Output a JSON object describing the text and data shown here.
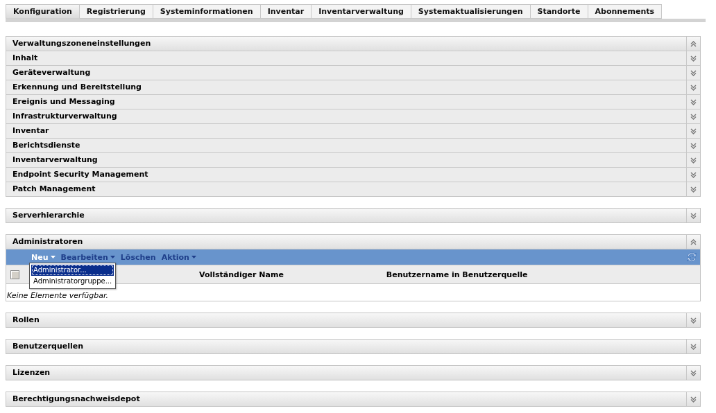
{
  "tabs": [
    {
      "label": "Konfiguration",
      "selected": true
    },
    {
      "label": "Registrierung",
      "selected": false
    },
    {
      "label": "Systeminformationen",
      "selected": false
    },
    {
      "label": "Inventar",
      "selected": false
    },
    {
      "label": "Inventarverwaltung",
      "selected": false
    },
    {
      "label": "Systemaktualisierungen",
      "selected": false
    },
    {
      "label": "Standorte",
      "selected": false
    },
    {
      "label": "Abonnements",
      "selected": false
    }
  ],
  "sections": [
    {
      "title": "Verwaltungszoneneinstellungen",
      "expanded": true,
      "children": [
        {
          "title": "Inhalt",
          "expanded": false
        },
        {
          "title": "Geräteverwaltung",
          "expanded": false
        },
        {
          "title": "Erkennung und Bereitstellung",
          "expanded": false
        },
        {
          "title": "Ereignis und Messaging",
          "expanded": false
        },
        {
          "title": "Infrastrukturverwaltung",
          "expanded": false
        },
        {
          "title": "Inventar",
          "expanded": false
        },
        {
          "title": "Berichtsdienste",
          "expanded": false
        },
        {
          "title": "Inventarverwaltung",
          "expanded": false
        },
        {
          "title": "Endpoint Security Management",
          "expanded": false
        },
        {
          "title": "Patch Management",
          "expanded": false
        }
      ]
    },
    {
      "title": "Serverhierarchie",
      "expanded": false
    },
    {
      "title": "Administratoren",
      "expanded": true,
      "toolbar": [
        {
          "label": "Neu",
          "dropdown": true,
          "open": true
        },
        {
          "label": "Bearbeiten",
          "dropdown": true,
          "open": false
        },
        {
          "label": "Löschen",
          "dropdown": false,
          "open": false
        },
        {
          "label": "Aktion",
          "dropdown": true,
          "open": false
        }
      ],
      "menu": [
        {
          "label": "Administrator...",
          "selected": true
        },
        {
          "label": "Administratorgruppe...",
          "selected": false
        }
      ],
      "table": {
        "select_all_checked": false,
        "columns": [
          "Vollständiger Name",
          "Benutzername in Benutzerquelle"
        ],
        "empty_text": "Keine Elemente verfügbar."
      }
    },
    {
      "title": "Rollen",
      "expanded": false
    },
    {
      "title": "Benutzerquellen",
      "expanded": false
    },
    {
      "title": "Lizenzen",
      "expanded": false
    },
    {
      "title": "Berechtigungsnachweisdepot",
      "expanded": false
    }
  ]
}
